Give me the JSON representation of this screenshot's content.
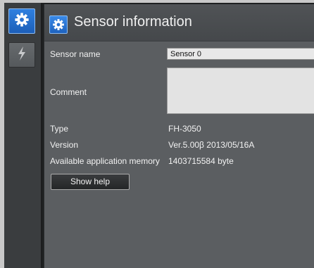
{
  "sidebar": {
    "items": [
      {
        "icon": "gear-icon",
        "active": true
      },
      {
        "icon": "lightning-icon",
        "active": false
      }
    ]
  },
  "header": {
    "title": "Sensor information",
    "icon": "gear-icon"
  },
  "fields": {
    "sensor_name": {
      "label": "Sensor name",
      "value": "Sensor 0"
    },
    "comment": {
      "label": "Comment",
      "value": ""
    },
    "type": {
      "label": "Type",
      "value": "FH-3050"
    },
    "version": {
      "label": "Version",
      "value": "Ver.5.00β 2013/05/16A"
    },
    "memory": {
      "label": "Available application memory",
      "value": "1403715584 byte"
    }
  },
  "buttons": {
    "show_help": "Show help"
  },
  "colors": {
    "accent": "#2a78dc",
    "panel": "#5b5e61",
    "sidebar": "#3a3d3f"
  }
}
